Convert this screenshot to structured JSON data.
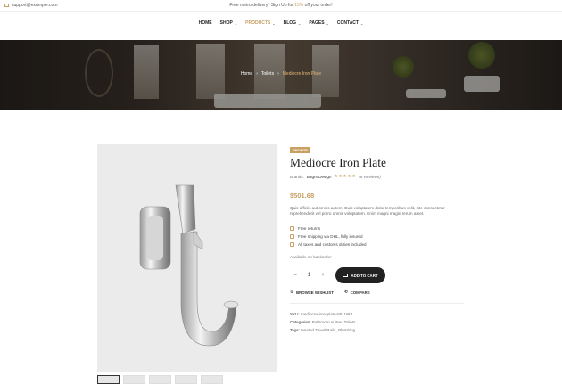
{
  "topbar": {
    "email": "support@example.com",
    "promo_before": "Free metro delivery* Sign Up for ",
    "promo_code": "15%",
    "promo_after": " off your order!"
  },
  "nav": {
    "items": [
      {
        "label": "HOME",
        "dropdown": false
      },
      {
        "label": "SHOP",
        "dropdown": true
      },
      {
        "label": "PRODUCTS",
        "dropdown": true,
        "active": true
      },
      {
        "label": "BLOG",
        "dropdown": true
      },
      {
        "label": "PAGES",
        "dropdown": true
      },
      {
        "label": "CONTACT",
        "dropdown": true
      }
    ]
  },
  "breadcrumb": {
    "home": "Home",
    "category": "Toilets",
    "current": "Mediocre Iron Plate",
    "separator": "›"
  },
  "product": {
    "badge": "BRONZE",
    "title": "Mediocre Iron Plate",
    "brands_label": "Brands:",
    "brand": "BagnoDesign",
    "stars": "★★★★★",
    "reviews": "(6 Reviews)",
    "price": "$501.68",
    "description": "Quis officiis aut omnis autem. Duis voluptatem dolor temporibus velit, iste consectetur reprehenderit vel porro omnis voluptatem. Enim magni magni rerum amet.",
    "features": [
      "Free returns",
      "Free shipping via DHL, fully insured",
      "All taxes and customs duties included"
    ],
    "availability": "Available on backorder",
    "quantity": "1",
    "minus": "−",
    "plus": "+",
    "add_to_cart": "ADD TO CART",
    "wishlist": "BROWSE WISHLIST",
    "compare": "COMPARE",
    "sku_label": "SKU:",
    "sku": "mediocre-iron-plate-58119k2",
    "categories_label": "Categories:",
    "categories": "Bathroom suites, Toilets",
    "tags_label": "Tags:",
    "tags": "Heated Towel Rails, Plumbing"
  },
  "colors": {
    "accent": "#c7a062",
    "dark": "#222222"
  }
}
